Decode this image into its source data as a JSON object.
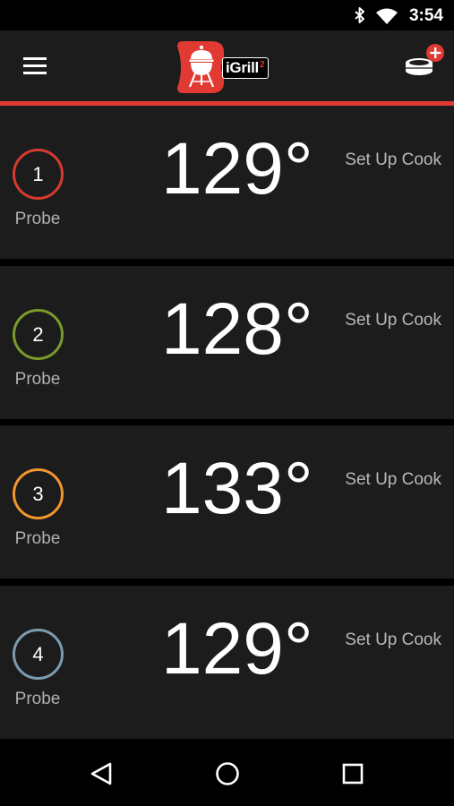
{
  "status_bar": {
    "time": "3:54",
    "icons": [
      "bluetooth-icon",
      "wifi-icon"
    ]
  },
  "app_bar": {
    "menu_icon": "hamburger-menu-icon",
    "logo_text": "iGrill",
    "logo_superscript": "2",
    "device_icon": "add-device-icon"
  },
  "colors": {
    "accent": "#e03a32",
    "card_background": "#1c1c1c",
    "probe_1": "#d63a30",
    "probe_2": "#7a9a2a",
    "probe_3": "#f2962d",
    "probe_4": "#7d9bb0"
  },
  "probes": [
    {
      "number": "1",
      "label": "Probe",
      "temperature": "129°",
      "action": "Set Up Cook"
    },
    {
      "number": "2",
      "label": "Probe",
      "temperature": "128°",
      "action": "Set Up Cook"
    },
    {
      "number": "3",
      "label": "Probe",
      "temperature": "133°",
      "action": "Set Up Cook"
    },
    {
      "number": "4",
      "label": "Probe",
      "temperature": "129°",
      "action": "Set Up Cook"
    }
  ],
  "nav_bar": {
    "icons": [
      "back-icon",
      "home-icon",
      "recents-icon"
    ]
  }
}
